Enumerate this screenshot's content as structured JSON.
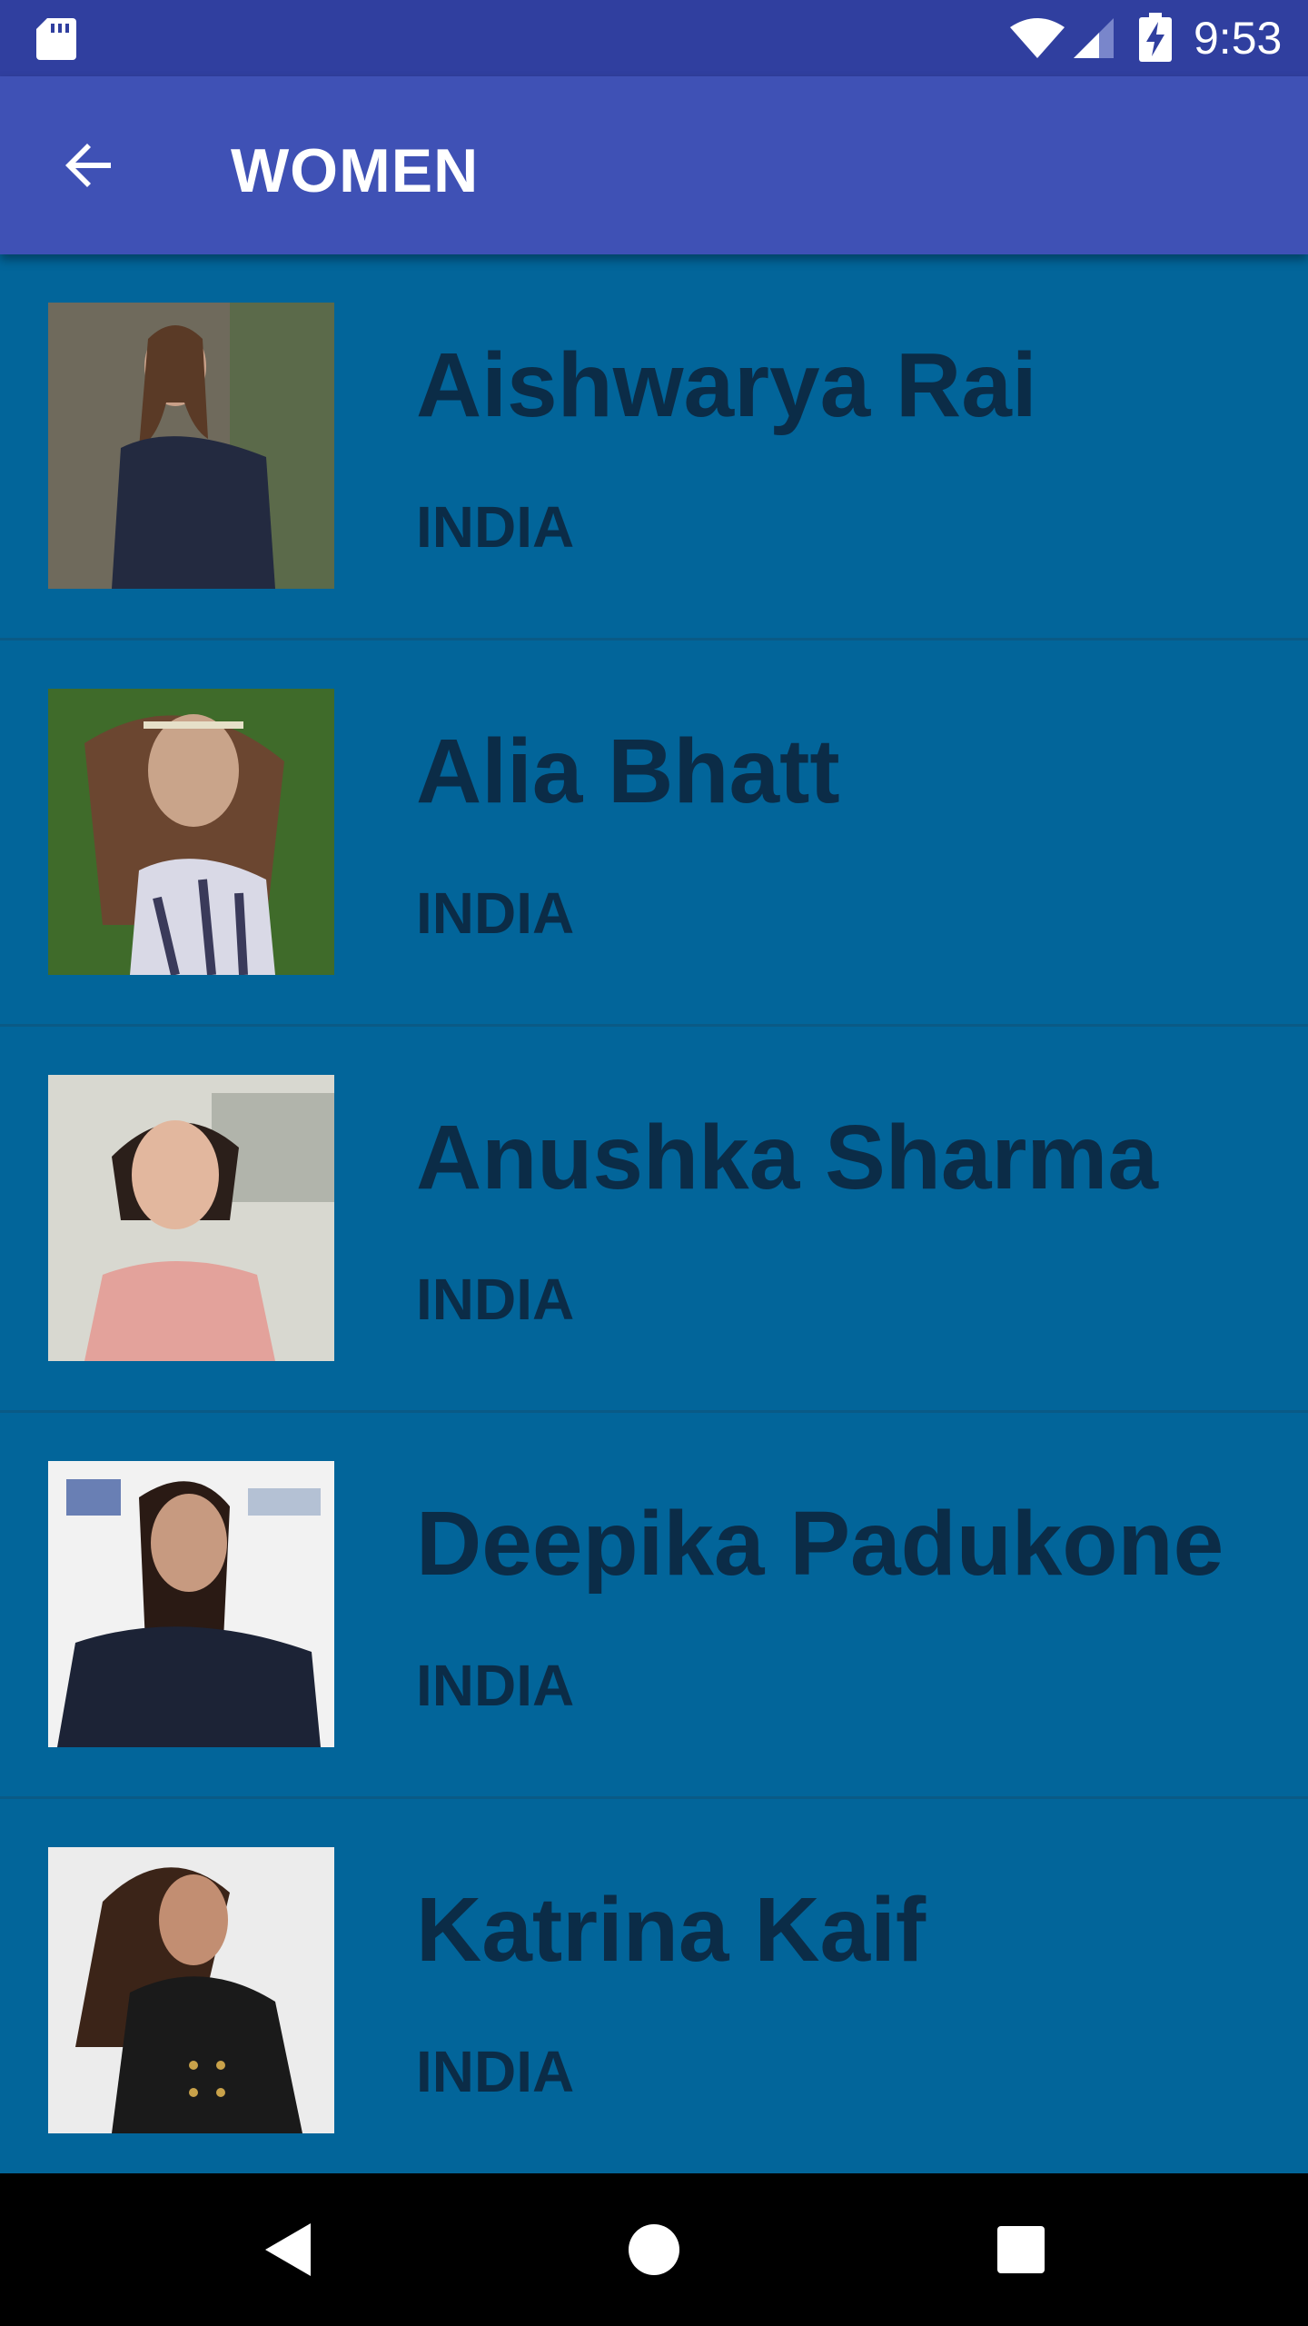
{
  "status_bar": {
    "time": "9:53",
    "icons": [
      "sd-card-icon",
      "wifi-icon",
      "cell-signal-icon",
      "battery-charging-icon"
    ]
  },
  "app_bar": {
    "title": "WOMEN",
    "back_icon": "arrow-left-icon"
  },
  "list": {
    "items": [
      {
        "name": "Aishwarya Rai",
        "country": "INDIA",
        "photo_bg": "#6f6a5c",
        "photo_fg": "#232a40"
      },
      {
        "name": "Alia Bhatt",
        "country": "INDIA",
        "photo_bg": "#3f6b2a",
        "photo_fg": "#c9a48a"
      },
      {
        "name": "Anushka Sharma",
        "country": "INDIA",
        "photo_bg": "#d8d8d0",
        "photo_fg": "#e3a29b"
      },
      {
        "name": "Deepika Padukone",
        "country": "INDIA",
        "photo_bg": "#f2f2f2",
        "photo_fg": "#1c2336"
      },
      {
        "name": "Katrina Kaif",
        "country": "INDIA",
        "photo_bg": "#ececec",
        "photo_fg": "#1a1a1a"
      }
    ]
  },
  "nav_bar": {
    "icons": [
      "back-triangle-icon",
      "home-circle-icon",
      "recents-square-icon"
    ]
  }
}
